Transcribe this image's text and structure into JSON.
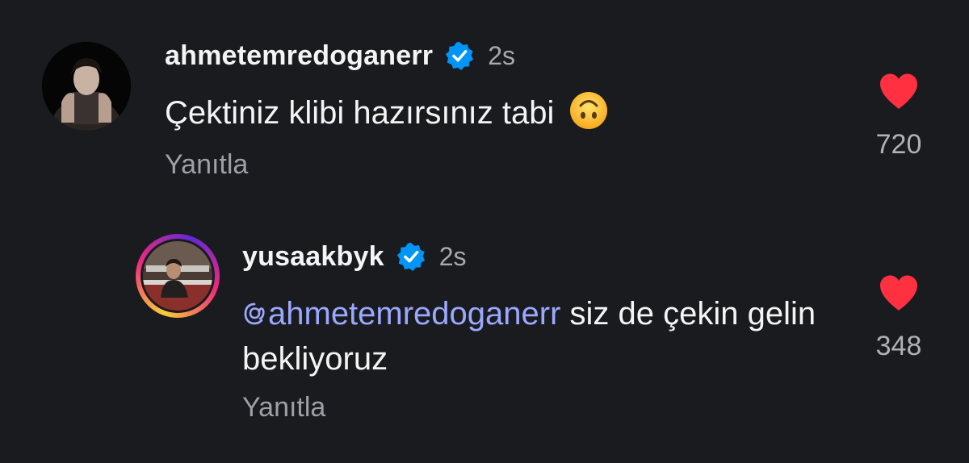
{
  "comments": [
    {
      "username": "ahmetemredoganerr",
      "verified_icon": "verified-badge-icon",
      "time": "2s",
      "text": "Çektiniz klibi hazırsınız tabi",
      "emoji": "upside-down-face-emoji",
      "reply_label": "Yanıtla",
      "like_count": "720",
      "like_icon": "heart-icon"
    },
    {
      "username": "yusaakbyk",
      "verified_icon": "verified-badge-icon",
      "time": "2s",
      "mention": "ahmetemredoganerr",
      "mention_icon": "threads-icon",
      "text_after_mention": " siz de çekin gelin bekliyoruz",
      "reply_label": "Yanıtla",
      "like_count": "348",
      "like_icon": "heart-icon",
      "avatar_ring": "story-ring"
    }
  ],
  "colors": {
    "background": "#1a1b1f",
    "text": "#f4f4f5",
    "muted": "#9f9fa5",
    "verified": "#0095f6",
    "heart": "#ff3040",
    "mention": "#9aa8ff"
  }
}
